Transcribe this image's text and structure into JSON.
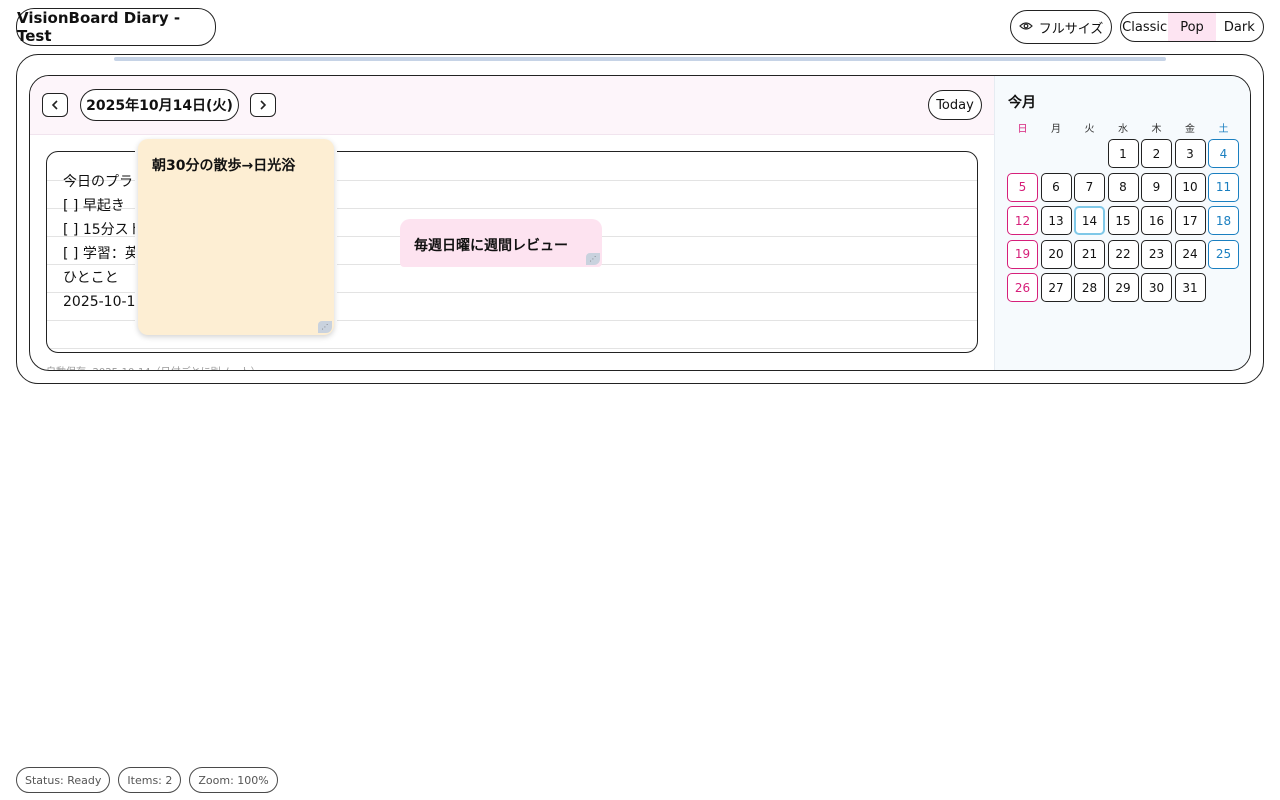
{
  "app": {
    "title": "VisionBoard Diary - Test"
  },
  "toolbar": {
    "fullsize_label": "フルサイズ",
    "themes": [
      {
        "label": "Classic",
        "active": false
      },
      {
        "label": "Pop",
        "active": true
      },
      {
        "label": "Dark",
        "active": false
      }
    ]
  },
  "diary": {
    "date_label": "2025年10月14日(火)",
    "prev_label": "‹",
    "next_label": "›",
    "today_label": "Today",
    "note_lines": [
      "今日のプラン",
      "[ ] 早起き",
      "[ ] 15分スト",
      "[ ] 学習：英",
      "ひとこと",
      "2025-10-1"
    ],
    "autosave_text": "自動保存: 2025-10-14（日付ごとに別ノート）"
  },
  "stickies": [
    {
      "text": "朝30分の散歩→日光浴",
      "color": "#fdeed3"
    },
    {
      "text": "毎週日曜に週間レビュー",
      "color": "#fde3f0"
    }
  ],
  "calendar": {
    "title": "今月",
    "weekdays": [
      "日",
      "月",
      "火",
      "水",
      "木",
      "金",
      "土"
    ],
    "first_weekday": 3,
    "days_in_month": 31,
    "today": 14
  },
  "status": {
    "state": "Status: Ready",
    "items": "Items: 2",
    "zoom": "Zoom: 100%"
  },
  "colors": {
    "accent_pink": "#d61f7a",
    "accent_blue": "#1a7fc0",
    "today_border": "#7fc8e8",
    "header_bg": "#fdf5fa"
  }
}
